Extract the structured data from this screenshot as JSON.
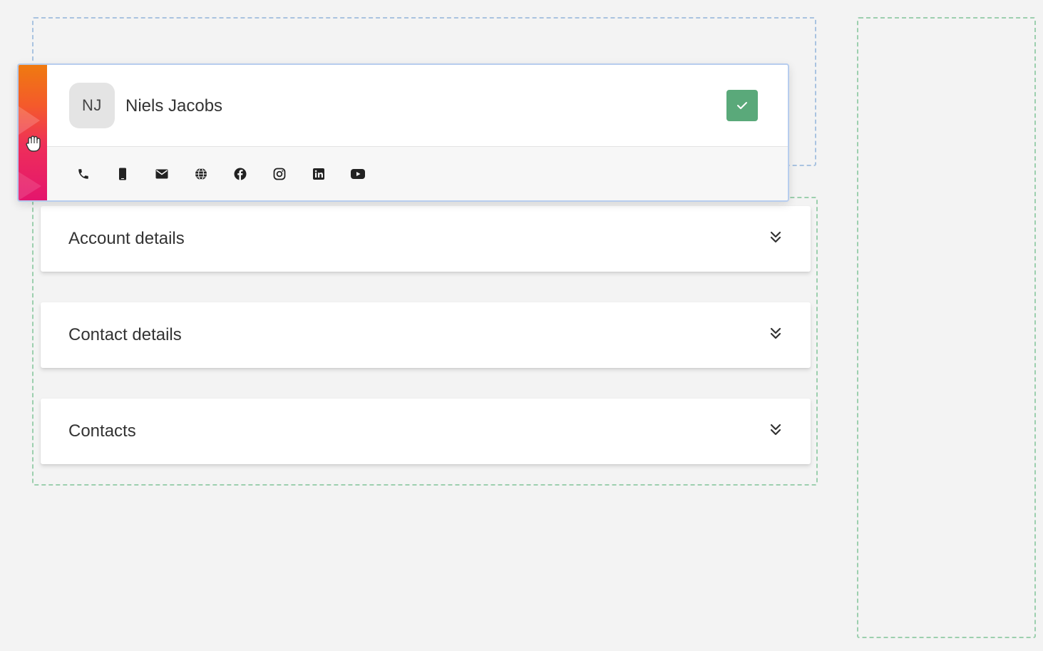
{
  "contact": {
    "initials": "NJ",
    "name": "Niels Jacobs"
  },
  "social_icons": [
    "phone-icon",
    "mobile-icon",
    "email-icon",
    "website-icon",
    "facebook-icon",
    "instagram-icon",
    "linkedin-icon",
    "youtube-icon"
  ],
  "sections": [
    {
      "title": "Account details"
    },
    {
      "title": "Contact details"
    },
    {
      "title": "Contacts"
    }
  ],
  "colors": {
    "check_button": "#5aa97a",
    "drag_gradient_top": "#ef7a10",
    "drag_gradient_bottom": "#e4156d",
    "dropzone_blue": "#a9c3e0",
    "dropzone_green": "#9ccfae"
  }
}
